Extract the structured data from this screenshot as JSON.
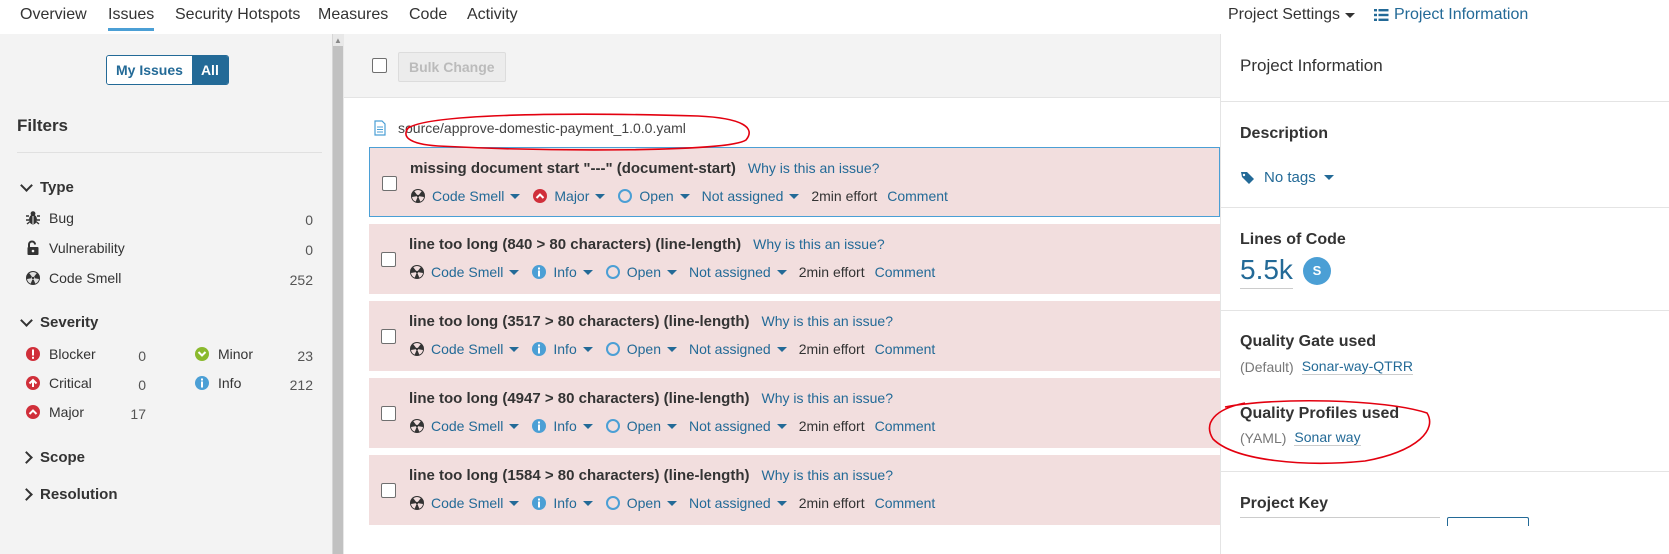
{
  "nav": {
    "tabs": [
      "Overview",
      "Issues",
      "Security Hotspots",
      "Measures",
      "Code",
      "Activity"
    ],
    "active_tab": "Issues",
    "project_settings": "Project Settings",
    "project_information": "Project Information"
  },
  "sidebar": {
    "my_issues": "My Issues",
    "all": "All",
    "filters_title": "Filters",
    "type": {
      "title": "Type",
      "items": [
        {
          "label": "Bug",
          "count": "0",
          "icon": "bug-icon"
        },
        {
          "label": "Vulnerability",
          "count": "0",
          "icon": "lock-icon"
        },
        {
          "label": "Code Smell",
          "count": "252",
          "icon": "code-smell-icon"
        }
      ]
    },
    "severity": {
      "title": "Severity",
      "items": [
        {
          "label": "Blocker",
          "count": "0",
          "icon": "blocker-icon"
        },
        {
          "label": "Minor",
          "count": "23",
          "icon": "minor-icon"
        },
        {
          "label": "Critical",
          "count": "0",
          "icon": "critical-icon"
        },
        {
          "label": "Info",
          "count": "212",
          "icon": "info-icon"
        },
        {
          "label": "Major",
          "count": "17",
          "icon": "major-icon"
        }
      ]
    },
    "scope": "Scope",
    "resolution": "Resolution"
  },
  "main": {
    "bulk_change": "Bulk Change",
    "file_path": "source/approve-domestic-payment_1.0.0.yaml",
    "why_label": "Why is this an issue?",
    "issues": [
      {
        "message": "missing document start \"---\" (document-start)",
        "type": "Code Smell",
        "severity": "Major",
        "status": "Open",
        "assignee": "Not assigned",
        "effort": "2min effort",
        "comment": "Comment"
      },
      {
        "message": "line too long (840 > 80 characters) (line-length)",
        "type": "Code Smell",
        "severity": "Info",
        "status": "Open",
        "assignee": "Not assigned",
        "effort": "2min effort",
        "comment": "Comment"
      },
      {
        "message": "line too long (3517 > 80 characters) (line-length)",
        "type": "Code Smell",
        "severity": "Info",
        "status": "Open",
        "assignee": "Not assigned",
        "effort": "2min effort",
        "comment": "Comment"
      },
      {
        "message": "line too long (4947 > 80 characters) (line-length)",
        "type": "Code Smell",
        "severity": "Info",
        "status": "Open",
        "assignee": "Not assigned",
        "effort": "2min effort",
        "comment": "Comment"
      },
      {
        "message": "line too long (1584 > 80 characters) (line-length)",
        "type": "Code Smell",
        "severity": "Info",
        "status": "Open",
        "assignee": "Not assigned",
        "effort": "2min effort",
        "comment": "Comment"
      }
    ]
  },
  "panel": {
    "title": "Project Information",
    "description_title": "Description",
    "no_tags": "No tags",
    "loc_title": "Lines of Code",
    "loc_value": "5.5k",
    "loc_rating": "S",
    "quality_gate_title": "Quality Gate used",
    "quality_gate_prefix": "(Default)",
    "quality_gate_name": "Sonar-way-QTRR",
    "quality_profiles_title": "Quality Profiles used",
    "quality_profile_lang": "(YAML)",
    "quality_profile_name": "Sonar way",
    "project_key_title": "Project Key"
  },
  "colors": {
    "link": "#236a97",
    "issue_bg": "#f2dede",
    "annotation": "#e3000f",
    "rating": "#4b9fd5"
  }
}
